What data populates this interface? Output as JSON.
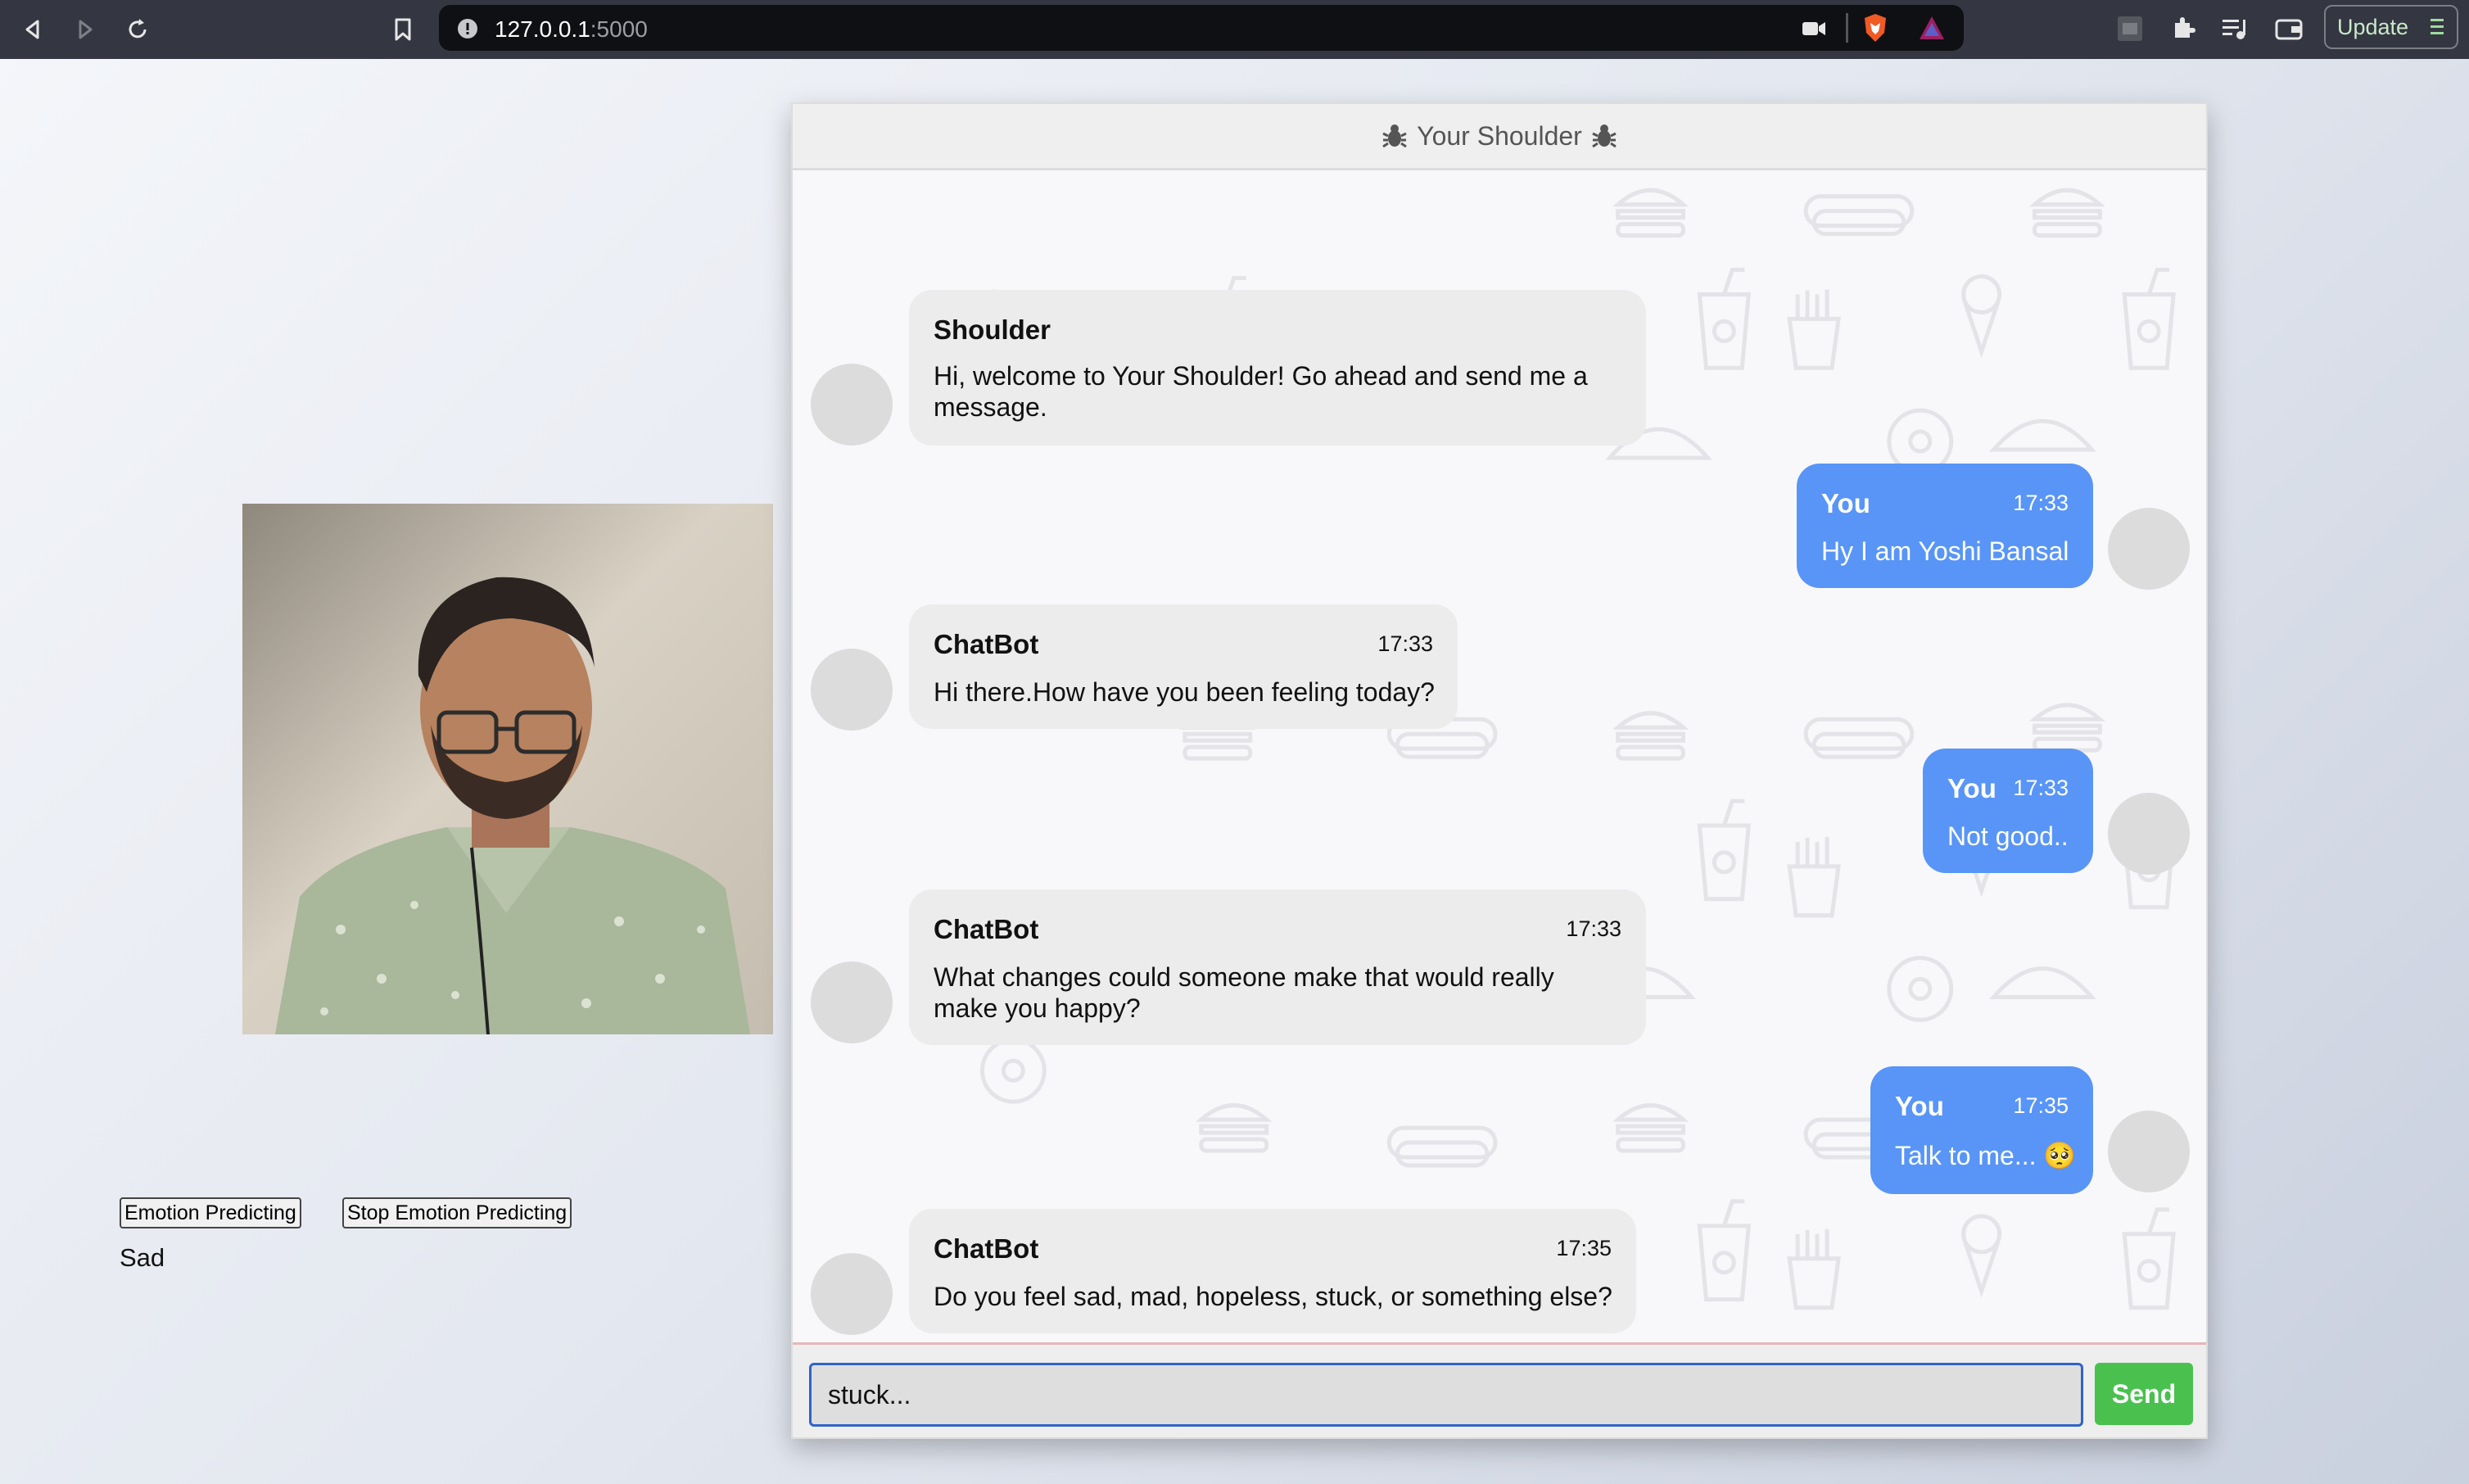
{
  "browser": {
    "url_host": "127.0.0.1",
    "url_port": ":5000",
    "update_label": "Update"
  },
  "emotion": {
    "start_label": "Emotion Predicting",
    "stop_label": "Stop Emotion Predicting",
    "current": "Sad"
  },
  "chat": {
    "title": "Your Shoulder",
    "messages": [
      {
        "sender": "Shoulder",
        "time": "",
        "text": "Hi, welcome to Your Shoulder! Go ahead and send me a message.",
        "side": "left"
      },
      {
        "sender": "You",
        "time": "17:33",
        "text": "Hy I am Yoshi Bansal",
        "side": "right"
      },
      {
        "sender": "ChatBot",
        "time": "17:33",
        "text": "Hi there.How have you been feeling today?",
        "side": "left"
      },
      {
        "sender": "You",
        "time": "17:33",
        "text": "Not good..",
        "side": "right"
      },
      {
        "sender": "ChatBot",
        "time": "17:33",
        "text": "What changes could someone make that would really make you happy?",
        "side": "left"
      },
      {
        "sender": "You",
        "time": "17:35",
        "text": "Talk to me... 🥺",
        "side": "right"
      },
      {
        "sender": "ChatBot",
        "time": "17:35",
        "text": "Do you feel sad, mad, hopeless, stuck, or something else?",
        "side": "left"
      }
    ],
    "input_value": "stuck...",
    "send_label": "Send"
  }
}
